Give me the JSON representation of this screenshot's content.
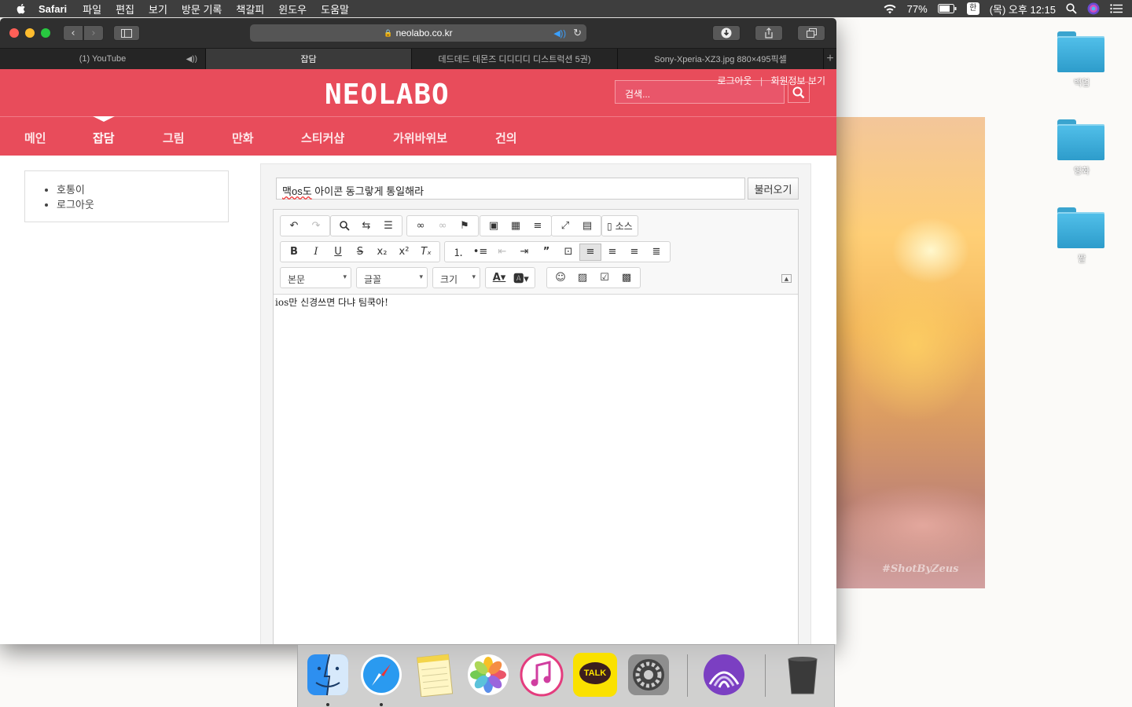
{
  "menubar": {
    "app_name": "Safari",
    "menus": [
      "파일",
      "편집",
      "보기",
      "방문 기록",
      "책갈피",
      "윈도우",
      "도움말"
    ],
    "battery": "77%",
    "ime": "한",
    "clock": "(목) 오후 12:15"
  },
  "browser": {
    "url": "neolabo.co.kr",
    "tabs": [
      {
        "label": "(1) YouTube"
      },
      {
        "label": "잡담"
      },
      {
        "label": "데드데드 데몬즈 디디디디 디스트럭션 5권)"
      },
      {
        "label": "Sony-Xperia-XZ3.jpg 880×495픽셀"
      }
    ]
  },
  "site": {
    "logo": "NEOLABO",
    "search_placeholder": "검색...",
    "top_links": [
      "로그아웃",
      "회원정보 보기"
    ],
    "nav": [
      "메인",
      "잡담",
      "그림",
      "만화",
      "스티커샵",
      "가위바위보",
      "건의"
    ],
    "active_nav": "잡담",
    "sidebar_links": [
      "호통이",
      "로그아웃"
    ]
  },
  "post": {
    "title_prefix": "맥os도",
    "title_rest": " 아이콘 동그랗게 통일해라",
    "load_button": "불러오기",
    "body": "ios만 신경쓰면 다냐 팀쿡아!"
  },
  "editor": {
    "source_button": "소스",
    "format_select": "본문",
    "font_select": "글꼴",
    "size_select": "크기"
  },
  "desktop": {
    "folders": [
      "백업",
      "영화",
      "짤"
    ],
    "photo_watermark": "#ShotByZeus"
  },
  "dock": {
    "apps": [
      "Finder",
      "Safari",
      "Notes",
      "Photos",
      "iTunes",
      "KakaoTalk",
      "System Preferences",
      "BitTorrent",
      "Trash"
    ],
    "kakao_label": "TALK"
  }
}
